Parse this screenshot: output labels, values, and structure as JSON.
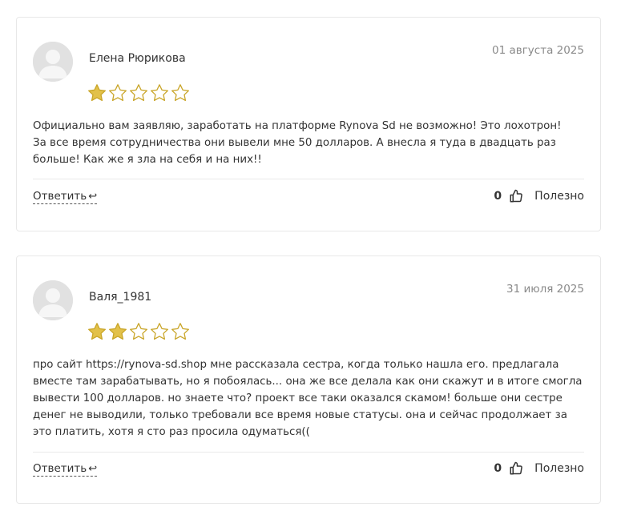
{
  "reviews": [
    {
      "author": "Елена Рюрикова",
      "date": "01 августа 2025",
      "rating": 1,
      "max_rating": 5,
      "text_lines": [
        "Официально вам заявляю, заработать на платформе Rynova Sd не возможно! Это лохотрон!",
        "За все время сотрудничества они вывели мне 50 долларов. А внесла я туда в двадцать раз",
        "больше! Как же я зла на себя и на них!!"
      ],
      "reply_label": "Ответить",
      "reply_arrow": "↩",
      "helpful_count": "0",
      "helpful_label": "Полезно"
    },
    {
      "author": "Валя_1981",
      "date": "31 июля 2025",
      "rating": 2,
      "max_rating": 5,
      "text_lines": [
        "про сайт https://rynova-sd.shop мне рассказала сестра, когда только нашла его. предлагала",
        "вместе там зарабатывать, но я побоялась... она же все делала как они скажут и в итоге смогла",
        "вывести 100 долларов. но знаете что? проект все таки оказался скамом! больше они сестре",
        "денег не выводили, только требовали все время новые статусы. она и сейчас продолжает за",
        "это платить, хотя я сто раз просила одуматься(("
      ],
      "reply_label": "Ответить",
      "reply_arrow": "↩",
      "helpful_count": "0",
      "helpful_label": "Полезно"
    }
  ],
  "icons": {
    "star_filled": "star-filled-icon",
    "star_empty": "star-empty-icon",
    "thumb": "thumbs-up-icon",
    "avatar": "user-avatar-icon"
  },
  "colors": {
    "star_fill": "#e2c14a",
    "star_stroke": "#c9a528",
    "border": "#e8e8e8",
    "date": "#8a8a8a",
    "text": "#333333"
  }
}
